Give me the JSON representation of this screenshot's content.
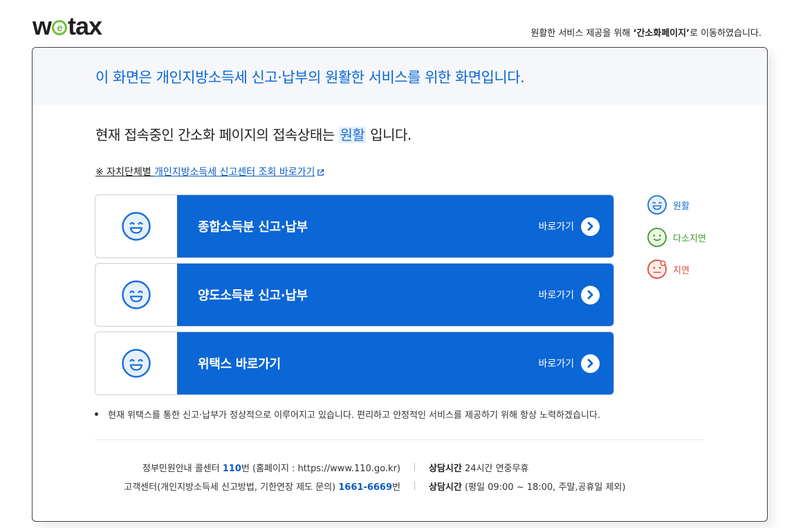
{
  "logo": {
    "prefix": "w",
    "e": "e",
    "suffix": "tax"
  },
  "top_notice": {
    "pre": "원활한 서비스 제공을 위해 ",
    "strong": "‘간소화페이지’",
    "post": "로 이동하였습니다."
  },
  "panel": {
    "heading": "이 화면은 개인지방소득세 신고·납부의 원활한 서비스를 위한 화면입니다.",
    "status": {
      "pre": "현재 접속중인 간소화 페이지의 접속상태는 ",
      "value": "원활",
      "post": " 입니다."
    },
    "local_link": {
      "prefix": "※ 자치단체별 ",
      "link": "개인지방소득세 신고센터 조회 바로가기"
    }
  },
  "cards": [
    {
      "title": "종합소득분 신고·납부",
      "go_label": "바로가기",
      "face": "smile-face-icon"
    },
    {
      "title": "양도소득분 신고·납부",
      "go_label": "바로가기",
      "face": "smile-face-icon"
    },
    {
      "title": "위택스 바로가기",
      "go_label": "바로가기",
      "face": "smile-face-icon"
    }
  ],
  "legend": [
    {
      "label": "원활",
      "color": "#1a70d6",
      "icon": "smile-face-icon"
    },
    {
      "label": "다소지연",
      "color": "#3a9a2a",
      "icon": "neutral-face-icon"
    },
    {
      "label": "지연",
      "color": "#e04a3a",
      "icon": "sad-face-icon"
    }
  ],
  "notice": "현재 위택스를 통한 신고·납부가 정상적으로 이루어지고 있습니다. 편리하고 안정적인 서비스를 제공하기 위해 항상 노력하겠습니다.",
  "footer": {
    "row1": {
      "pre": "정부민원안내 콜센터 ",
      "num": "110",
      "post": "번 (홈페이지 : https://www.110.go.kr)",
      "hours_label": "상담시간",
      "hours": " 24시간 연중무휴"
    },
    "row2": {
      "pre": "고객센터(개인지방소득세 신고방법, 기한연장 제도 문의) ",
      "num": "1661-6669",
      "post": "번",
      "hours_label": "상담시간",
      "hours": " (평일 09:00 ~ 18:00, 주말,공휴일 제외)"
    }
  },
  "colors": {
    "brand_blue": "#0b66d6",
    "logo_green": "#6fbf3a"
  }
}
